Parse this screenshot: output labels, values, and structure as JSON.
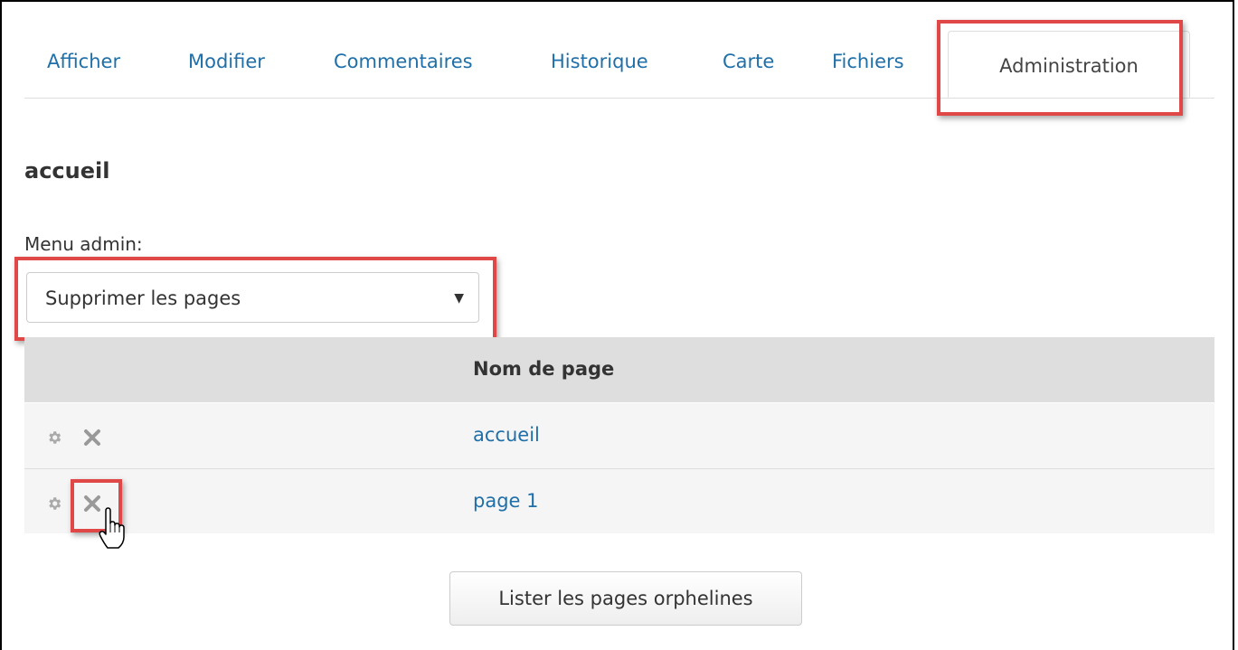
{
  "tabs": [
    {
      "label": "Afficher"
    },
    {
      "label": "Modifier"
    },
    {
      "label": "Commentaires"
    },
    {
      "label": "Historique"
    },
    {
      "label": "Carte"
    },
    {
      "label": "Fichiers"
    },
    {
      "label": "Administration",
      "active": true
    }
  ],
  "page": {
    "title": "accueil"
  },
  "admin_menu": {
    "label": "Menu admin:",
    "selected": "Supprimer les pages",
    "arrow_icon": "caret-down-icon"
  },
  "table": {
    "columns": [
      "",
      "Nom de page"
    ],
    "rows": [
      {
        "name": "accueil",
        "actions": [
          "gear-icon",
          "close-icon"
        ]
      },
      {
        "name": "page 1",
        "actions": [
          "gear-icon",
          "close-icon"
        ]
      }
    ]
  },
  "buttons": {
    "orphans": "Lister les pages orphelines"
  },
  "colors": {
    "link": "#1f6fa8",
    "highlight": "#e04848",
    "table_header": "#dedede",
    "row_bg": "#f5f5f5"
  }
}
